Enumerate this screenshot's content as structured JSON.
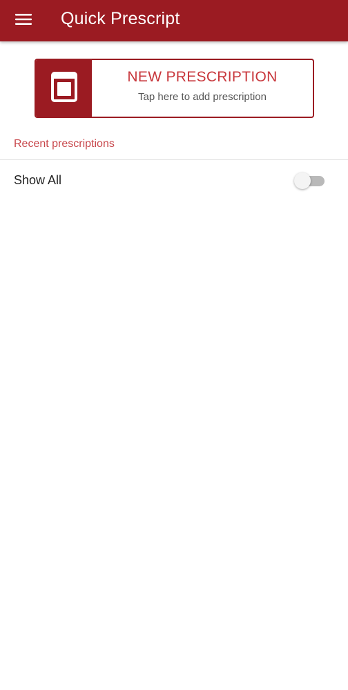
{
  "appbar": {
    "title": "Quick Prescript",
    "menu_icon": "hamburger-menu-icon",
    "background": "#9b1b22"
  },
  "new_prescription": {
    "title": "NEW PRESCRIPTION",
    "subtitle": "Tap here to add prescription",
    "icon": "prescription-pad-icon",
    "accent": "#9b1b22",
    "title_color": "#c8373c"
  },
  "recent": {
    "label": "Recent prescriptions",
    "label_color": "#c8474b",
    "show_all_label": "Show All",
    "show_all_on": false
  }
}
